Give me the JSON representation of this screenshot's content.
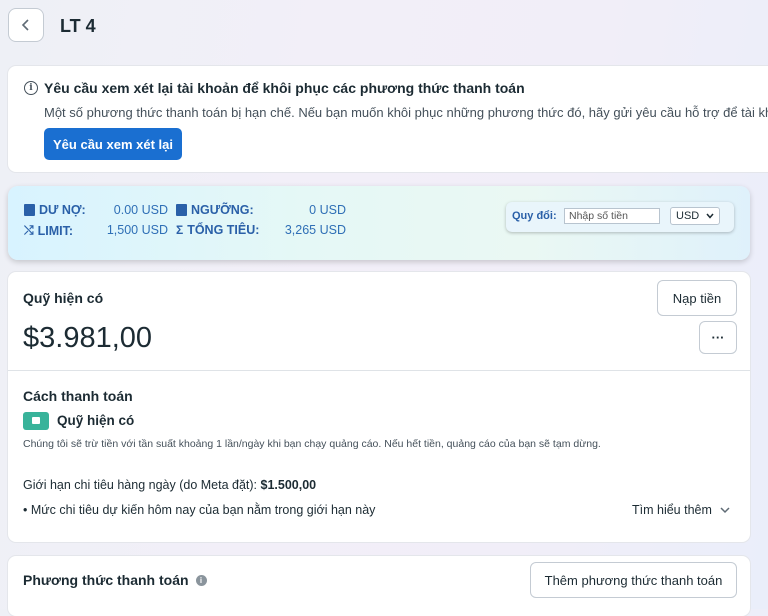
{
  "header": {
    "back_icon": "chevron-left-icon",
    "title": "LT 4"
  },
  "review_banner": {
    "icon": "info-icon",
    "title": "Yêu cầu xem xét lại tài khoản để khôi phục các phương thức thanh toán",
    "text": "Một số phương thức thanh toán bị hạn chế. Nếu bạn muốn khôi phục những phương thức đó, hãy gửi yêu cầu hỗ trợ để tài khoản",
    "button_label": "Yêu cầu xem xét lại"
  },
  "stats": {
    "du_no_label": "DƯ NỢ:",
    "du_no_value": "0.00 USD",
    "nguong_label": "NGƯỠNG:",
    "nguong_value": "0 USD",
    "limit_label": "LIMIT:",
    "limit_value": "1,500 USD",
    "tong_tieu_label": "TỔNG TIÊU:",
    "tong_tieu_value": "3,265 USD",
    "quy_doi_label": "Quy đổi:",
    "amount_placeholder": "Nhập số tiền",
    "currency_selected": "USD",
    "accent_color": "#2a60a8"
  },
  "funds": {
    "label": "Quỹ hiện có",
    "amount": "$3.981,00",
    "deposit_button": "Nạp tiền",
    "more_button": "···",
    "payment_method_label": "Cách thanh toán",
    "wallet_name": "Quỹ hiện có",
    "description": "Chúng tôi sẽ trừ tiền với tần suất khoảng 1 lần/ngày khi bạn chạy quảng cáo. Nếu hết tiền, quảng cáo của bạn sẽ tạm dừng.",
    "daily_limit_label": "Giới hạn chi tiêu hàng ngày (do Meta đặt):",
    "daily_limit_value": "$1.500,00",
    "bullet_text": "Mức chi tiêu dự kiến hôm nay của bạn nằm trong giới hạn này",
    "learn_more": "Tìm hiểu thêm"
  },
  "payment_methods": {
    "title": "Phương thức thanh toán",
    "add_button": "Thêm phương thức thanh toán"
  }
}
